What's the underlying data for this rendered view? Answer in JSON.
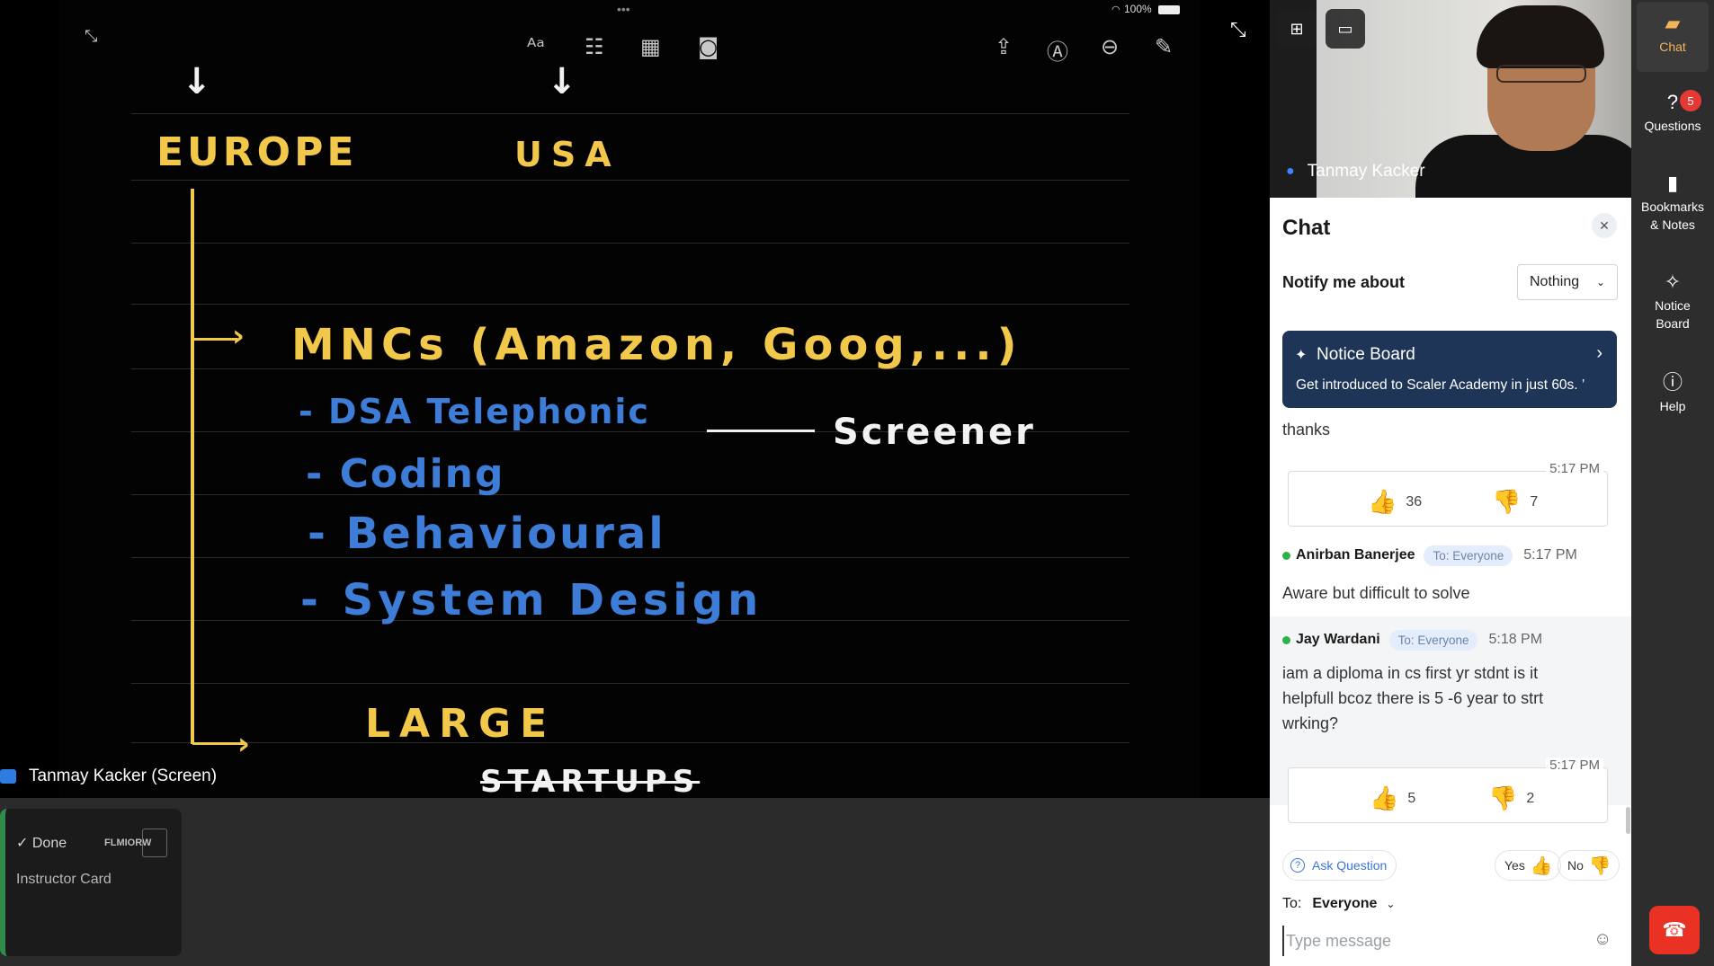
{
  "screen_share": {
    "label": "Tanmay Kacker (Screen)",
    "status_bar": "100%",
    "whiteboard": {
      "heading_left": "EUROPE",
      "heading_right": "USA",
      "line1": "MNCs (Amazon, Goog,...)",
      "items": [
        "- DSA Telephonic",
        "- Coding",
        "- Behavioural",
        "- System Design"
      ],
      "annotation": "Screener",
      "line2": "LARGE",
      "line3": "STARTUPS"
    }
  },
  "video": {
    "participant_name": "Tanmay Kacker"
  },
  "chat": {
    "title": "Chat",
    "notify_label": "Notify me about",
    "notify_value": "Nothing",
    "notice": {
      "title": "Notice Board",
      "body": "Get introduced to Scaler Academy in just 60s. ’"
    },
    "msg_thanks": "thanks",
    "reactions1": {
      "time": "5:17 PM",
      "up": "36",
      "down": "7"
    },
    "message1": {
      "sender": "Anirban Banerjee",
      "to": "To: Everyone",
      "time": "5:17 PM",
      "text": "Aware but difficult to solve"
    },
    "message2": {
      "sender": "Jay Wardani",
      "to": "To: Everyone",
      "time": "5:18 PM",
      "text": "iam a diploma in cs first yr stdnt is it helpfull bcoz there is 5 -6 year to strt wrking?"
    },
    "reactions2": {
      "time": "5:17 PM",
      "up": "5",
      "down": "2"
    },
    "ask_question": "Ask Question",
    "yes_label": "Yes",
    "no_label": "No",
    "to_label": "To:",
    "to_value": "Everyone",
    "input_placeholder": "Type message"
  },
  "rail": {
    "chat": "Chat",
    "questions": "Questions",
    "questions_badge": "5",
    "bookmarks_line1": "Bookmarks",
    "bookmarks_line2": "& Notes",
    "notice_line1": "Notice",
    "notice_line2": "Board",
    "help": "Help"
  },
  "card": {
    "done": "Done",
    "code": "FLMIORW",
    "name": "Instructor Card"
  },
  "colors": {
    "chat_bg": "#ffffff",
    "notice_bg": "#1e3557",
    "accent_blue": "#3a75d9",
    "end_call": "#ea3224",
    "online": "#2bb34a"
  }
}
